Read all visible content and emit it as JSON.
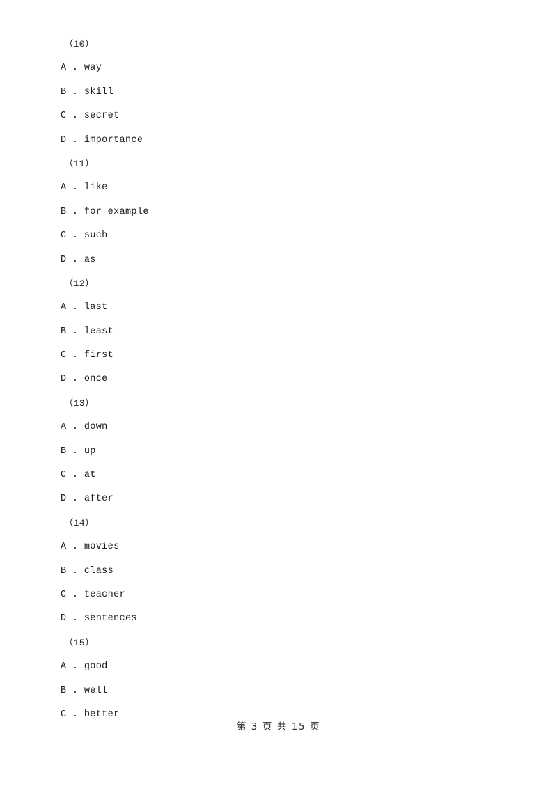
{
  "document": {
    "page_label": "第 3 页 共 15 页",
    "page_number": "3",
    "total_pages": "15"
  },
  "questions": [
    {
      "number": "（10）",
      "options": [
        {
          "letter": "A",
          "separator": " . ",
          "text": "way"
        },
        {
          "letter": "B",
          "separator": " . ",
          "text": "skill"
        },
        {
          "letter": "C",
          "separator": " . ",
          "text": "secret"
        },
        {
          "letter": "D",
          "separator": " . ",
          "text": "importance"
        }
      ]
    },
    {
      "number": "（11）",
      "options": [
        {
          "letter": "A",
          "separator": " . ",
          "text": "like"
        },
        {
          "letter": "B",
          "separator": " . ",
          "text": "for example"
        },
        {
          "letter": "C",
          "separator": " . ",
          "text": "such"
        },
        {
          "letter": "D",
          "separator": " . ",
          "text": "as"
        }
      ]
    },
    {
      "number": "（12）",
      "options": [
        {
          "letter": "A",
          "separator": " . ",
          "text": "last"
        },
        {
          "letter": "B",
          "separator": " . ",
          "text": "least"
        },
        {
          "letter": "C",
          "separator": " . ",
          "text": "first"
        },
        {
          "letter": "D",
          "separator": " . ",
          "text": "once"
        }
      ]
    },
    {
      "number": "（13）",
      "options": [
        {
          "letter": "A",
          "separator": " . ",
          "text": "down"
        },
        {
          "letter": "B",
          "separator": " . ",
          "text": "up"
        },
        {
          "letter": "C",
          "separator": " . ",
          "text": "at"
        },
        {
          "letter": "D",
          "separator": " . ",
          "text": "after"
        }
      ]
    },
    {
      "number": "（14）",
      "options": [
        {
          "letter": "A",
          "separator": " . ",
          "text": "movies"
        },
        {
          "letter": "B",
          "separator": " . ",
          "text": "class"
        },
        {
          "letter": "C",
          "separator": " . ",
          "text": "teacher"
        },
        {
          "letter": "D",
          "separator": " . ",
          "text": "sentences"
        }
      ]
    },
    {
      "number": "（15）",
      "options": [
        {
          "letter": "A",
          "separator": " . ",
          "text": "good"
        },
        {
          "letter": "B",
          "separator": " . ",
          "text": "well"
        },
        {
          "letter": "C",
          "separator": " . ",
          "text": "better"
        }
      ]
    }
  ]
}
